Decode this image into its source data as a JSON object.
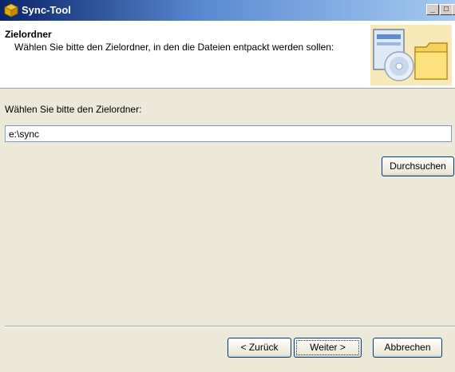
{
  "window": {
    "title": "Sync-Tool",
    "minimize": "_",
    "maximize": "□",
    "close": "X"
  },
  "header": {
    "title": "Zielordner",
    "subtitle": "Wählen Sie bitte den Zielordner, in den die Dateien entpackt werden sollen:"
  },
  "main": {
    "prompt": "Wählen Sie bitte den Zielordner:",
    "path_value": "e:\\sync",
    "browse_label": "Durchsuchen"
  },
  "footer": {
    "back_label": "< Zurück",
    "next_label": "Weiter >",
    "cancel_label": "Abbrechen"
  },
  "colors": {
    "titlebar_start": "#0a246a",
    "titlebar_end": "#a6caf0",
    "dialog_bg": "#ece9d8"
  }
}
